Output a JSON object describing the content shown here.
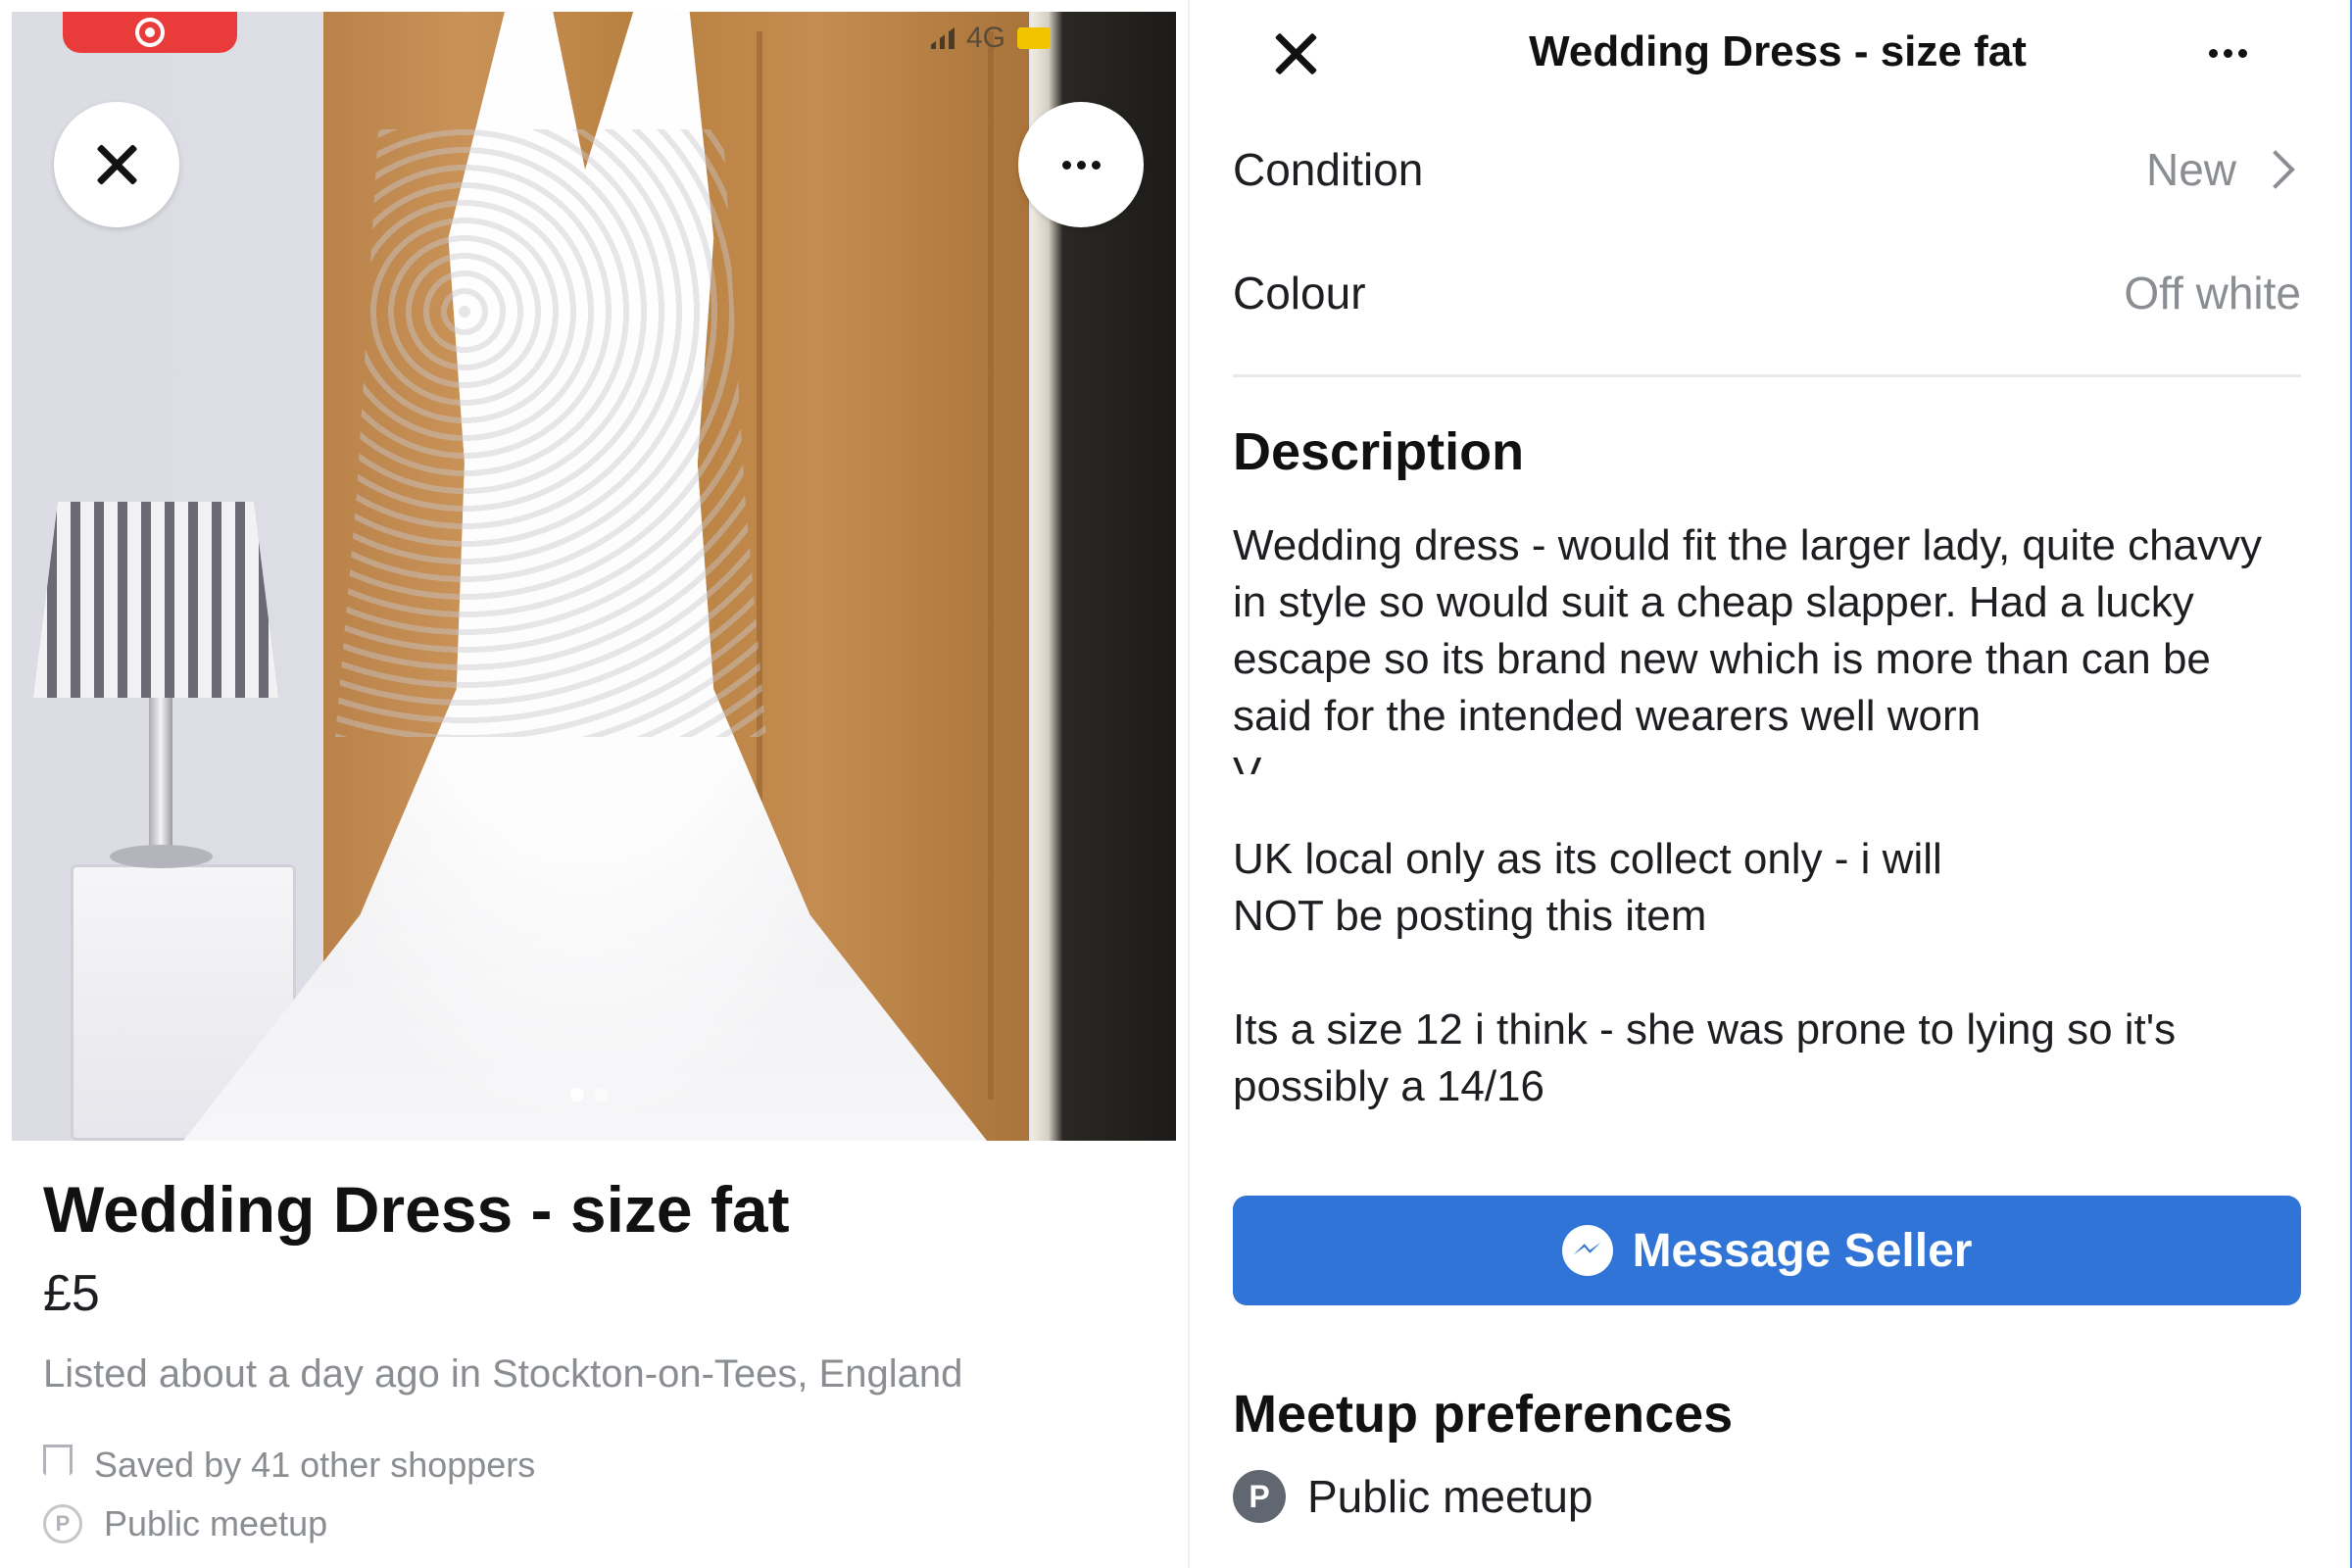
{
  "left": {
    "status": {
      "network": "4G"
    },
    "listing": {
      "title": "Wedding Dress - size fat",
      "price": "£5",
      "listed": "Listed about a day ago in Stockton-on-Tees, England",
      "saved": "Saved by 41 other shoppers",
      "meetup": "Public meetup"
    },
    "pager": {
      "current": 1,
      "total": 2
    }
  },
  "right": {
    "header_title": "Wedding Dress - size fat",
    "details": [
      {
        "label": "Condition",
        "value": "New"
      },
      {
        "label": "Colour",
        "value": "Off white"
      }
    ],
    "description_heading": "Description",
    "description": [
      "Wedding dress - would fit the larger lady, quite chavvy in style so would suit a cheap slapper. Had a lucky escape so its brand new which is more than can be said for the intended wearers well worn",
      "V...",
      "UK local only as its collect only - i will\nNOT be posting this item",
      "Its a size 12 i think - she was prone to lying so it's possibly a 14/16"
    ],
    "message_button": "Message Seller",
    "meetup_heading": "Meetup preferences",
    "meetup_value": "Public meetup"
  },
  "icons": {
    "close": "close-icon",
    "more": "more-icon",
    "bookmark": "bookmark-icon",
    "public_meetup": "public-meetup-icon",
    "messenger": "messenger-icon",
    "chevron": "chevron-right-icon"
  },
  "colors": {
    "accent": "#2f74d6",
    "muted_text": "#8a8d91",
    "recording_badge": "#ea3b3b"
  }
}
